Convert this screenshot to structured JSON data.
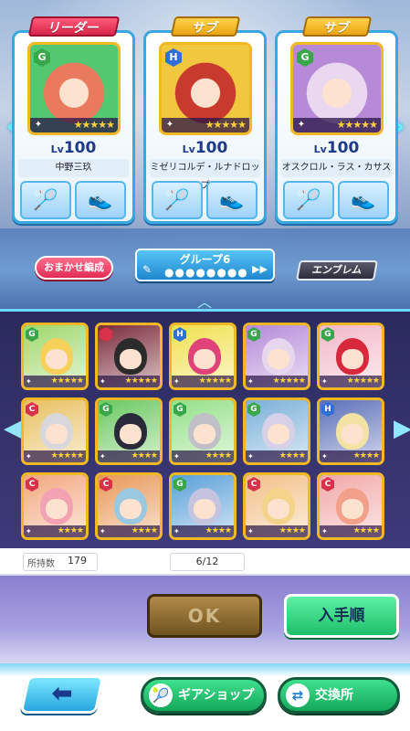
{
  "deck": {
    "cards": [
      {
        "role": "リーダー",
        "type": "G",
        "level_label": "Lv",
        "level": "100",
        "name": "中野三玖",
        "stars": "★★★★★",
        "portrait_color": "#ea7a5e",
        "bg_color": "#54c870"
      },
      {
        "role": "サブ",
        "type": "H",
        "level_label": "Lv",
        "level": "100",
        "name": "ミゼリコルデ・ルナドロップ",
        "stars": "★★★★★",
        "portrait_color": "#c93a2e",
        "bg_color": "#f2c740"
      },
      {
        "role": "サブ",
        "type": "G",
        "level_label": "Lv",
        "level": "100",
        "name": "オスクロル・ラス・カサス",
        "stars": "★★★★★",
        "portrait_color": "#e9d8f0",
        "bg_color": "#b78ad8"
      }
    ]
  },
  "controls": {
    "auto_formation": "おまかせ編成",
    "group_title": "グループ6",
    "group_dots": "●●●●●●●●",
    "emblem": "エンブレム"
  },
  "roster": {
    "tiles": [
      {
        "type": "G",
        "stars": "★★★★★",
        "hair": "#f5d05a",
        "bg": "#9fd86c"
      },
      {
        "type": "",
        "stars": "★★★★★",
        "hair": "#2b2b2b",
        "bg": "#7a2a3a"
      },
      {
        "type": "H",
        "stars": "★★★★★",
        "hair": "#e0427a",
        "bg": "#f0e04c"
      },
      {
        "type": "G",
        "stars": "★★★★★",
        "hair": "#e6d6ee",
        "bg": "#b48ad8"
      },
      {
        "type": "G",
        "stars": "★★★★★",
        "hair": "#d8283c",
        "bg": "#f2b8c8"
      },
      {
        "type": "C",
        "stars": "★★★★★",
        "hair": "#d8d8dc",
        "bg": "#e8c060"
      },
      {
        "type": "G",
        "stars": "★★★★",
        "hair": "#2a2a3a",
        "bg": "#6ac860"
      },
      {
        "type": "G",
        "stars": "★★★★",
        "hair": "#c0c0c6",
        "bg": "#94e088"
      },
      {
        "type": "G",
        "stars": "★★★★",
        "hair": "#d6d0e8",
        "bg": "#7ab0d8"
      },
      {
        "type": "H",
        "stars": "★★★★",
        "hair": "#f2e2a4",
        "bg": "#5a6fb8"
      },
      {
        "type": "C",
        "stars": "★★★★",
        "hair": "#f2a2b2",
        "bg": "#f2a880"
      },
      {
        "type": "C",
        "stars": "★★★★",
        "hair": "#9ac8e0",
        "bg": "#e89858"
      },
      {
        "type": "G",
        "stars": "★★★★",
        "hair": "#c4c4e0",
        "bg": "#5aa0d8"
      },
      {
        "type": "C",
        "stars": "★★★★",
        "hair": "#f4d48a",
        "bg": "#f2c088"
      },
      {
        "type": "C",
        "stars": "★★★★",
        "hair": "#f2a08a",
        "bg": "#f2a8a8"
      }
    ]
  },
  "inventory": {
    "owned_label": "所持数",
    "owned_count": "179",
    "selected": "6/12"
  },
  "actions": {
    "ok": "OK",
    "sort": "入手順"
  },
  "nav": {
    "back_arrow": "⬅",
    "gear_shop": "ギアショップ",
    "exchange": "交換所"
  },
  "colors": {
    "accent_blue": "#3aa7e0",
    "frame_gold": "#f2b824",
    "type_G": "#3aa64c",
    "type_H": "#2f6fd8",
    "type_C": "#d8324a"
  }
}
